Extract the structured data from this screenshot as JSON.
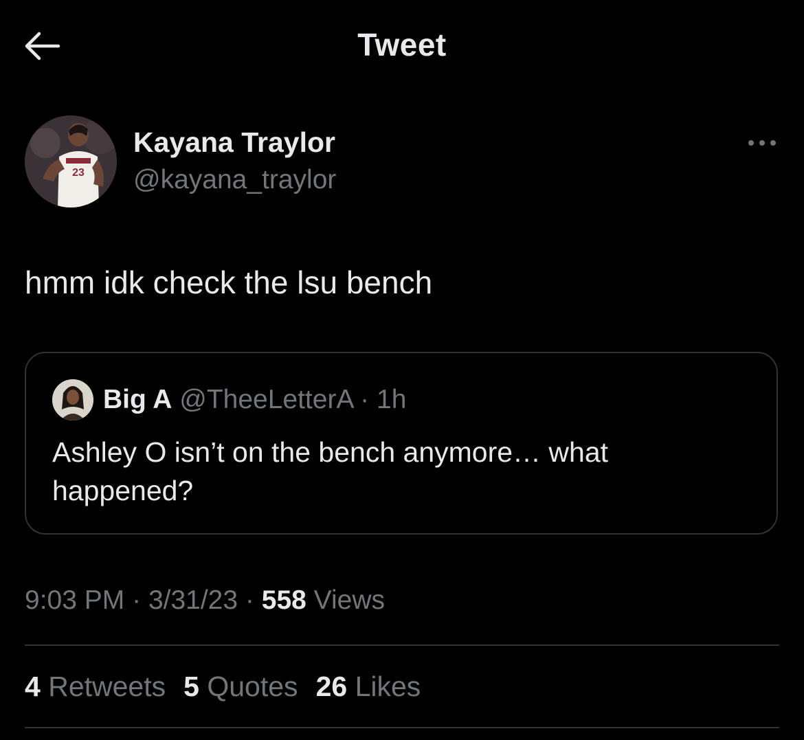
{
  "header": {
    "title": "Tweet",
    "back_icon": "arrow-left-icon"
  },
  "tweet": {
    "author": {
      "display_name": "Kayana Traylor",
      "handle": "@kayana_traylor",
      "avatar_icon": "profile-photo"
    },
    "more_icon": "ellipsis-icon",
    "text": "hmm idk check the lsu bench",
    "quoted": {
      "display_name": "Big A",
      "handle": "@TheeLetterA",
      "separator": "·",
      "age": "1h",
      "text": "Ashley O isn’t on the bench anymore… what happened?"
    },
    "time": "9:03 PM",
    "date": "3/31/23",
    "separator": "·",
    "views_count": "558",
    "views_label": "Views",
    "stats": {
      "retweets_count": "4",
      "retweets_label": "Retweets",
      "quotes_count": "5",
      "quotes_label": "Quotes",
      "likes_count": "26",
      "likes_label": "Likes"
    }
  },
  "colors": {
    "background": "#000000",
    "primary_text": "#e7e9ea",
    "secondary_text": "#71767b",
    "border": "#2f3336"
  }
}
